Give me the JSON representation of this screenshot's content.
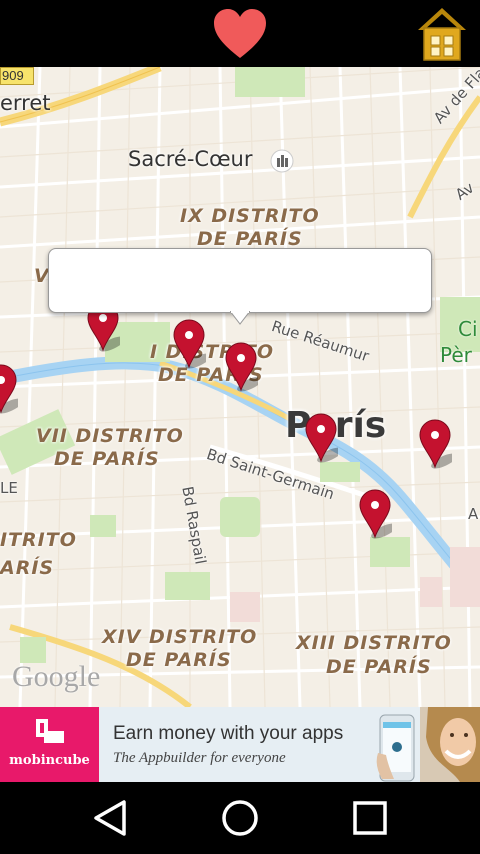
{
  "topbar": {
    "favorite_icon": "heart-icon",
    "home_icon": "home-icon",
    "heart_color": "#f05a5a",
    "home_color": "#d9a21b"
  },
  "map": {
    "road_shield": "909",
    "labels": {
      "erret": "erret",
      "sacre_coeur": "Sacré-Cœur",
      "ix_line1": "IX DISTRITO",
      "ix_line2": "DE PARÍS",
      "i_line1": "I DISTRITO",
      "i_line2": "DE PARÍS",
      "vii_line1": "VII DISTRITO",
      "vii_line2": "DE PARÍS",
      "xiv_line1": "XIV DISTRITO",
      "xiv_line2": "DE PARÍS",
      "xiii_line1": "XIII DISTRITO",
      "xiii_line2": "DE PARÍS",
      "left_distrito": "ITRITO",
      "left_paris": "ARÍS",
      "left_le": "LE",
      "v_partial": "V",
      "paris_city": "París",
      "rue_reaumur": "Rue Réaumur",
      "bd_saint_germain": "Bd Saint-Germain",
      "bd_raspail": "Bd Raspail",
      "av_flandre": "Av de Fla",
      "av_partial": "Av",
      "a_partial": "A",
      "cite_partial": "Ci",
      "pere_partial": "Pèr"
    },
    "attribution": "Google",
    "markers": [
      "map-pin-1",
      "map-pin-2",
      "map-pin-3",
      "map-pin-4",
      "map-pin-5",
      "map-pin-6",
      "map-pin-7"
    ],
    "info_window": {
      "text": ""
    }
  },
  "ad": {
    "brand": "mobincube",
    "headline": "Earn money with your apps",
    "subline": "The Appbuilder for everyone",
    "brand_color": "#e8196a"
  },
  "navbar": {
    "back_icon": "back-triangle-icon",
    "home_icon": "home-circle-icon",
    "recents_icon": "recents-square-icon"
  }
}
